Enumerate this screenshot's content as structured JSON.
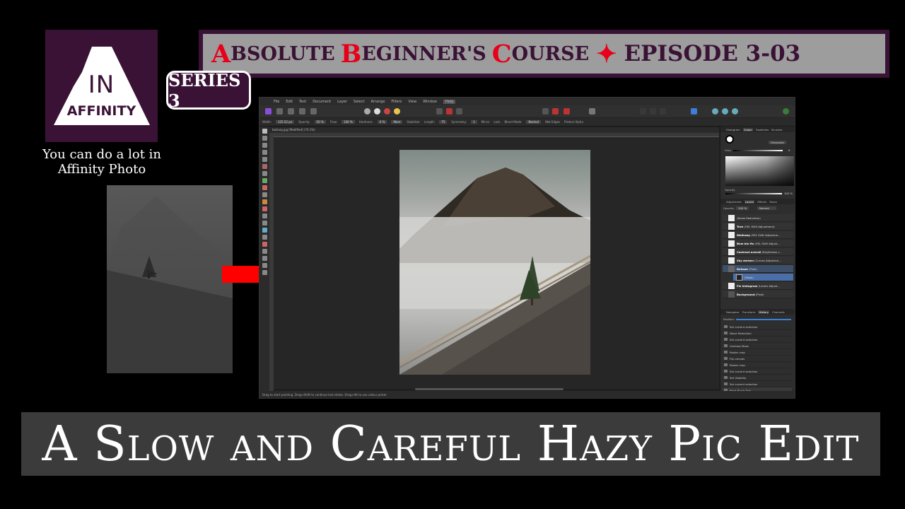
{
  "logo": {
    "line1": "IN",
    "line2": "AFFINITY"
  },
  "tagline": "You can do a lot in Affinity Photo",
  "banner": {
    "a_cap": "A",
    "a_rest": "BSOLUTE ",
    "b_cap": "B",
    "b_rest": "EGINNER'S ",
    "c_cap": "C",
    "c_rest": "OURSE",
    "star": "✦",
    "episode": "EPISODE 3-03"
  },
  "series_badge": "SERIES 3",
  "title": "A Slow and Careful Hazy Pic Edit",
  "app": {
    "menu": [
      "File",
      "Edit",
      "Text",
      "Document",
      "Layer",
      "Select",
      "Arrange",
      "Filters",
      "View",
      "Window",
      "Help"
    ],
    "context": {
      "width_label": "Width:",
      "width_value": "125.52 px",
      "opacity_label": "Opacity:",
      "opacity_value": "50 %",
      "flow_label": "Flow:",
      "flow_value": "100 %",
      "hardness_label": "Hardness:",
      "hardness_value": "0 %",
      "more": "More",
      "stabiliser": "Stabiliser",
      "length_label": "Length:",
      "length_value": "75",
      "symmetry_label": "Symmetry:",
      "symmetry_value": "1",
      "mirror": "Mirror",
      "lock": "Lock",
      "blend_label": "Blend Mode:",
      "blend_value": "Normal",
      "wet_edges": "Wet Edges",
      "protect_alpha": "Protect Alpha"
    },
    "document_tab": "bwhazy.jpg [Modified] (74.1%)",
    "status": "Drag to start painting. Drag+Shift to continue last stroke. Drag+Alt to use colour picker.",
    "panel_tabs_top": [
      "Histogram",
      "Colour",
      "Swatches",
      "Brushes"
    ],
    "colour_mode": "Greyscale",
    "grey_label": "Grey",
    "grey_value": "0",
    "colour_opacity_label": "Opacity",
    "colour_opacity_value": "100 %",
    "panel_tabs_mid": [
      "Adjustment",
      "Layers",
      "Effects",
      "Stock"
    ],
    "layers_opacity_label": "Opacity:",
    "layers_opacity_value": "100 %",
    "layers_blend": "Normal",
    "layers": [
      {
        "name": "",
        "type": "(Noise Reduction)"
      },
      {
        "name": "Tree",
        "type": "(HSL Shift Adjustment)"
      },
      {
        "name": "Walkway",
        "type": "(HSL Shift Adjustme..."
      },
      {
        "name": "Blue bin fix",
        "type": "(HSL Shift Adjust..."
      },
      {
        "name": "Contrast overall",
        "type": "(Brightness /..."
      },
      {
        "name": "Sky darken",
        "type": "(Curves Adjustme..."
      },
      {
        "name": "Dehaze",
        "type": "(Pixel)"
      },
      {
        "name": "",
        "type": "(Mask)"
      },
      {
        "name": "Fix histogram",
        "type": "(Levels Adjust..."
      },
      {
        "name": "Background",
        "type": "(Pixel)"
      }
    ],
    "panel_tabs_bottom": [
      "Navigator",
      "Transform",
      "History",
      "Channels"
    ],
    "position_label": "Position:",
    "history": [
      "Set current selection",
      "Noise Reduction",
      "Set current selection",
      "Unsharp Mask",
      "Raster crop",
      "Flip canvas",
      "Raster crop",
      "Set current selection",
      "Set Visibility",
      "Set current selection",
      "Paint Brush Tool"
    ]
  },
  "colors": {
    "brand_purple": "#3a1236",
    "accent_red": "#e8001a",
    "banner_grey": "#9d9d9d",
    "title_grey": "#3b3b3b"
  }
}
